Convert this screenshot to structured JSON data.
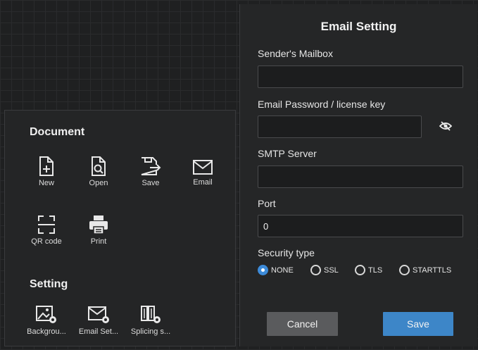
{
  "document_section": {
    "title": "Document",
    "tools": [
      {
        "label": "New",
        "icon": "new-file-icon"
      },
      {
        "label": "Open",
        "icon": "open-file-icon"
      },
      {
        "label": "Save",
        "icon": "save-icon"
      },
      {
        "label": "Email",
        "icon": "email-icon"
      },
      {
        "label": "QR code",
        "icon": "qr-code-icon"
      },
      {
        "label": "Print",
        "icon": "print-icon"
      }
    ]
  },
  "setting_section": {
    "title": "Setting",
    "tools": [
      {
        "label": "Backgrou...",
        "icon": "background-settings-icon"
      },
      {
        "label": "Email Set...",
        "icon": "email-settings-icon"
      },
      {
        "label": "Splicing s...",
        "icon": "splicing-settings-icon"
      }
    ]
  },
  "email_setting": {
    "title": "Email Setting",
    "sender_label": "Sender's Mailbox",
    "sender_value": "",
    "password_label": "Email Password / license key",
    "password_value": "",
    "smtp_label": "SMTP Server",
    "smtp_value": "",
    "port_label": "Port",
    "port_value": "0",
    "security_label": "Security type",
    "security_options": [
      "NONE",
      "SSL",
      "TLS",
      "STARTTLS"
    ],
    "security_selected": "NONE",
    "cancel_label": "Cancel",
    "save_label": "Save"
  },
  "colors": {
    "accent": "#3d86c8",
    "background": "#1f2021",
    "panel": "#252627"
  }
}
